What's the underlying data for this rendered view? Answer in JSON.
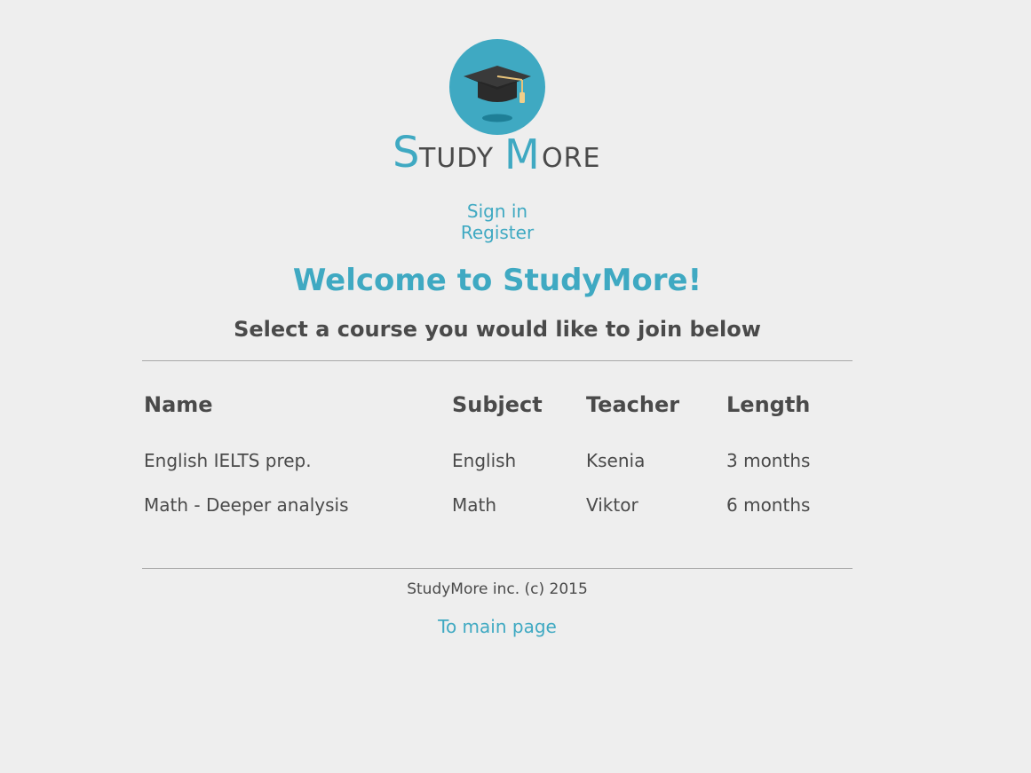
{
  "brand": {
    "name_part1": "Study",
    "name_part2": "More",
    "logo_icon": "graduation-cap-icon",
    "accent_color": "#3fa9c2",
    "text_color": "#4a4a4a"
  },
  "auth": {
    "sign_in": "Sign in",
    "register": "Register"
  },
  "main": {
    "heading": "Welcome to StudyMore!",
    "subheading": "Select a course you would like to join below"
  },
  "courses": {
    "headers": {
      "name": "Name",
      "subject": "Subject",
      "teacher": "Teacher",
      "length": "Length"
    },
    "rows": [
      {
        "name": "English IELTS prep.",
        "subject": "English",
        "teacher": "Ksenia",
        "length": "3 months"
      },
      {
        "name": "Math - Deeper analysis",
        "subject": "Math",
        "teacher": "Viktor",
        "length": "6 months"
      }
    ]
  },
  "footer": {
    "copyright": "StudyMore inc. (c) 2015",
    "main_page_link": "To main page"
  }
}
